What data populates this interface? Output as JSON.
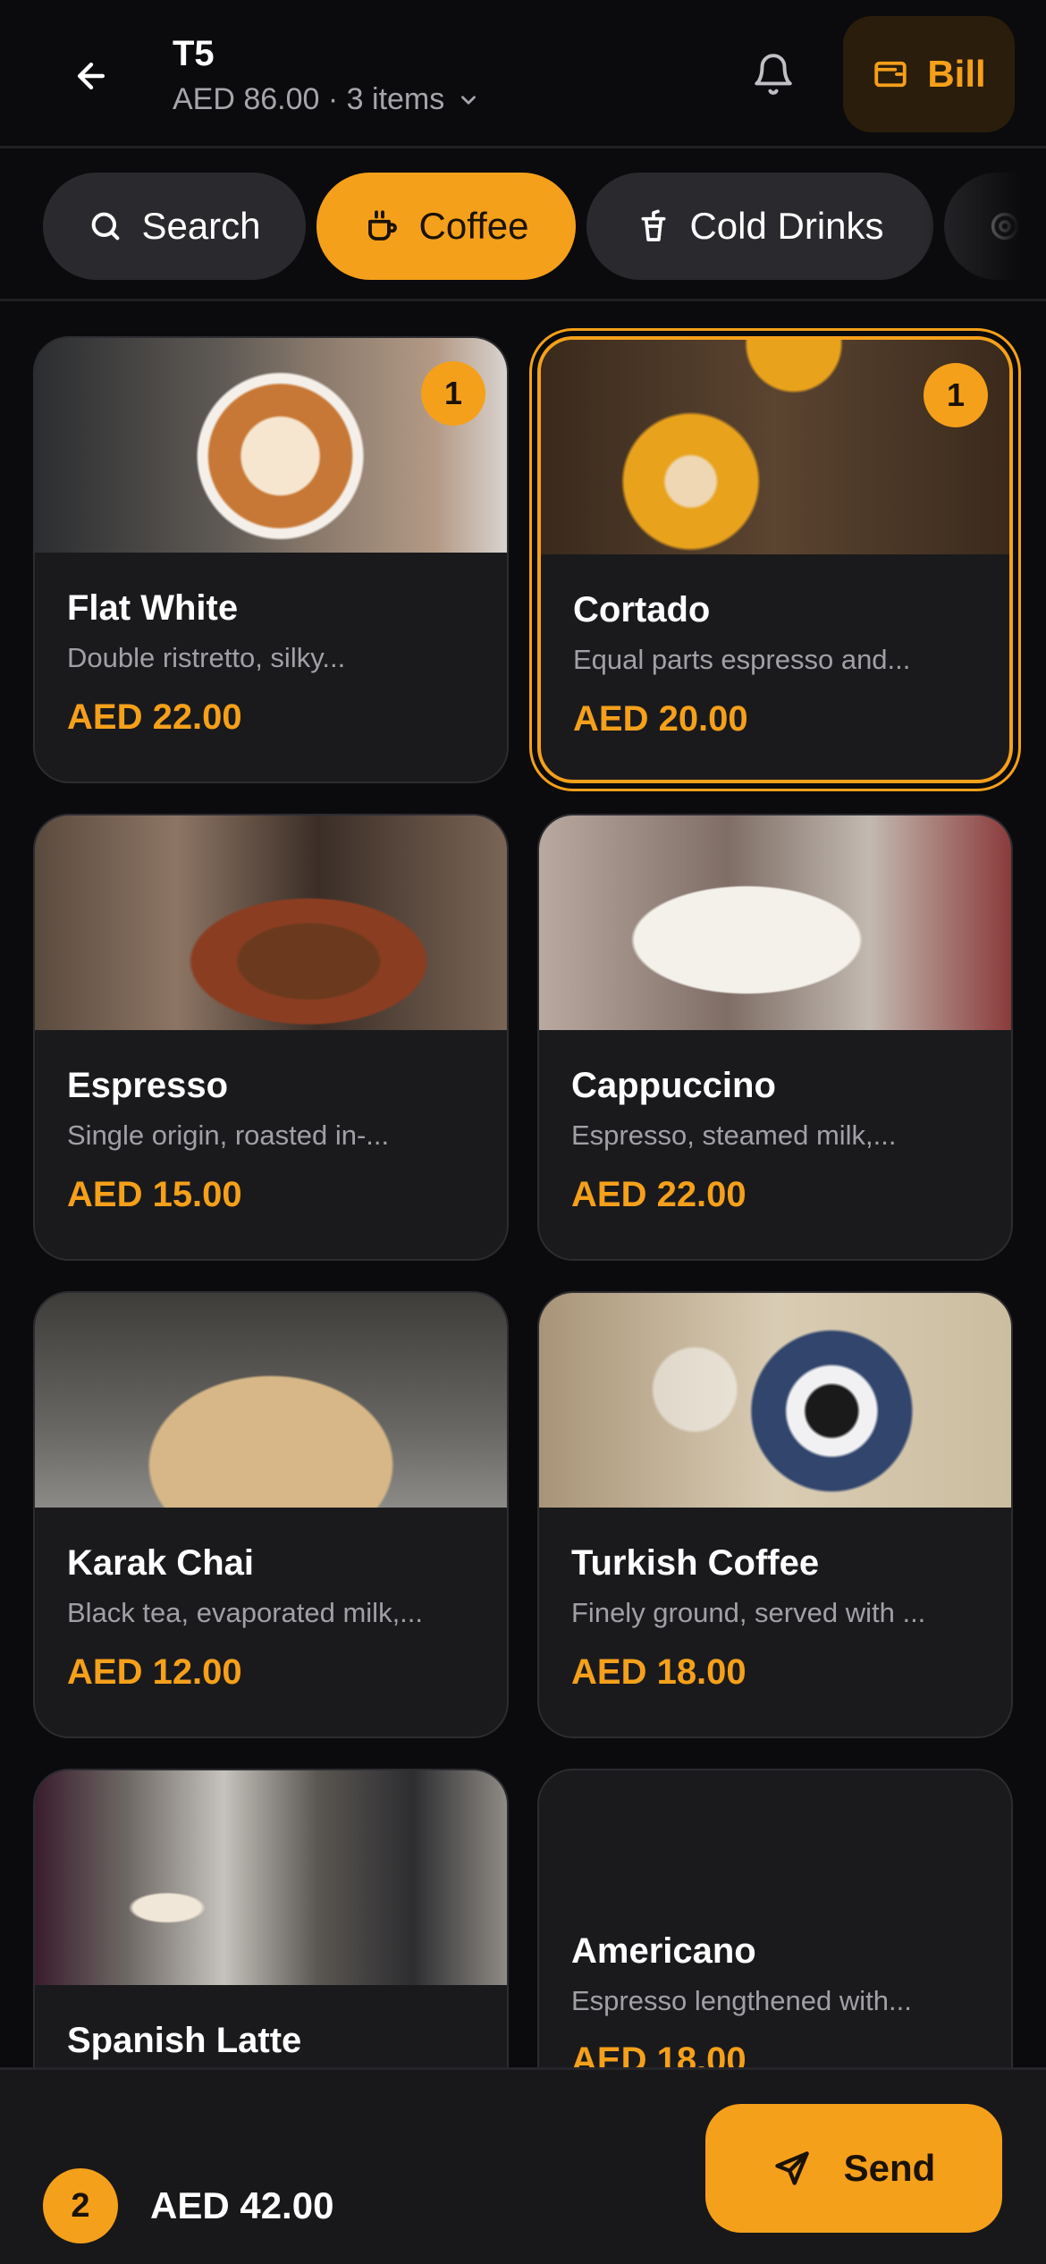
{
  "header": {
    "title": "T5",
    "subtitle": "AED 86.00 · 3 items",
    "bill_label": "Bill"
  },
  "tabs": [
    {
      "label": "Search",
      "icon": "search-icon",
      "active": false
    },
    {
      "label": "Coffee",
      "icon": "coffee-cup-icon",
      "active": true
    },
    {
      "label": "Cold Drinks",
      "icon": "iced-cup-icon",
      "active": false
    },
    {
      "label": "",
      "icon": "food-icon",
      "active": false
    }
  ],
  "items": [
    {
      "name": "Flat White",
      "desc": "Double ristretto, silky...",
      "price": "AED 22.00",
      "qty": "1"
    },
    {
      "name": "Cortado",
      "desc": "Equal parts espresso and...",
      "price": "AED 20.00",
      "qty": "1"
    },
    {
      "name": "Espresso",
      "desc": "Single origin, roasted in-...",
      "price": "AED 15.00"
    },
    {
      "name": "Cappuccino",
      "desc": "Espresso, steamed milk,...",
      "price": "AED 22.00"
    },
    {
      "name": "Karak Chai",
      "desc": "Black tea, evaporated milk,...",
      "price": "AED 12.00"
    },
    {
      "name": "Turkish Coffee",
      "desc": "Finely ground, served with ...",
      "price": "AED 18.00"
    },
    {
      "name": "Spanish Latte",
      "desc": "",
      "price": ""
    },
    {
      "name": "Americano",
      "desc": "Espresso lengthened with...",
      "price": "AED 18.00"
    }
  ],
  "bottom": {
    "count": "2",
    "total": "AED 42.00",
    "send_label": "Send"
  },
  "colors": {
    "accent": "#f5a01a",
    "background": "#0b0b0d",
    "card": "#1a1a1d"
  }
}
